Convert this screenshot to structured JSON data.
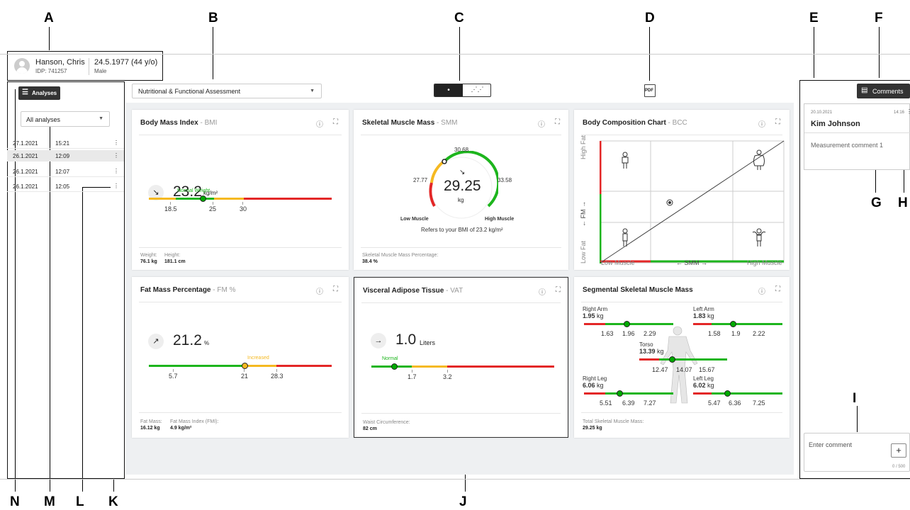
{
  "callouts": {
    "a": "A",
    "b": "B",
    "c": "C",
    "d": "D",
    "e": "E",
    "f": "F",
    "g": "G",
    "h": "H",
    "i": "I",
    "j": "J",
    "k": "K",
    "l": "L",
    "m": "M",
    "n": "N"
  },
  "patient": {
    "name": "Hanson, Chris",
    "idp": "IDP: 741257",
    "dob": "24.5.1977 (44 y/o)",
    "sex": "Male"
  },
  "sidebar": {
    "analyses_label": "Analyses",
    "filter": "All analyses",
    "rows": [
      {
        "date": "27.1.2021",
        "time": "15:21"
      },
      {
        "date": "26.1.2021",
        "time": "12:09"
      },
      {
        "date": "26.1.2021",
        "time": "12:07"
      },
      {
        "date": "26.1.2021",
        "time": "12:05"
      }
    ]
  },
  "assessment": "Nutritional & Functional Assessment",
  "pdf_label": "PDF",
  "bmi": {
    "title": "Body Mass Index",
    "abbr": " - BMI",
    "value": "23.2",
    "unit": "kg/m²",
    "category": "Normal Weight",
    "ticks": [
      "18.5",
      "25",
      "30"
    ],
    "weight_label": "Weight:",
    "weight": "76.1 kg",
    "height_label": "Height:",
    "height": "181.1 cm"
  },
  "smm": {
    "title": "Skeletal Muscle Mass",
    "abbr": " - SMM",
    "value": "29.25",
    "unit": "kg",
    "top": "30.68",
    "left": "27.77",
    "right": "33.58",
    "low": "Low Muscle",
    "high": "High Muscle",
    "note": "Refers to your BMI of 23.2 kg/m²",
    "pct_label": "Skeletal Muscle Mass Percentage:",
    "pct": "38.4 %"
  },
  "bcc": {
    "title": "Body Composition Chart",
    "abbr": " - BCC",
    "y_high": "High Fat",
    "y_mid": "← FM →",
    "y_low": "Low Fat",
    "x_low": "Low Muscle",
    "x_mid": "← SMM →",
    "x_high": "High Muscle"
  },
  "fm": {
    "title": "Fat Mass Percentage",
    "abbr": " - FM %",
    "value": "21.2",
    "unit": "%",
    "category": "Increased",
    "ticks": [
      "5.7",
      "21",
      "28.3"
    ],
    "mass_label": "Fat Mass:",
    "mass": "16.12 kg",
    "fmi_label": "Fat Mass Index (FMI):",
    "fmi": "4.9 kg/m²"
  },
  "vat": {
    "title": "Visceral Adipose Tissue",
    "abbr": " - VAT",
    "value": "1.0",
    "unit": "Liters",
    "category": "Normal",
    "ticks": [
      "1.7",
      "3.2"
    ],
    "waist_label": "Waist Circumference:",
    "waist": "82 cm"
  },
  "seg": {
    "title": "Segmental Skeletal Muscle Mass",
    "ra": {
      "label": "Right Arm",
      "value": "1.95",
      "ticks": [
        "1.63",
        "1.96",
        "2.29"
      ]
    },
    "la": {
      "label": "Left Arm",
      "value": "1.83",
      "ticks": [
        "1.58",
        "1.9",
        "2.22"
      ]
    },
    "to": {
      "label": "Torso",
      "value": "13.39",
      "ticks": [
        "12.47",
        "14.07",
        "15.67"
      ]
    },
    "rl": {
      "label": "Right Leg",
      "value": "6.06",
      "ticks": [
        "5.51",
        "6.39",
        "7.27"
      ]
    },
    "ll": {
      "label": "Left Leg",
      "value": "6.02",
      "ticks": [
        "5.47",
        "6.36",
        "7.25"
      ]
    },
    "unit": "kg",
    "total_label": "Total Skeletal Muscle Mass:",
    "total": "29.25 kg"
  },
  "comments": {
    "button": "Comments",
    "date": "20.10.2021",
    "time": "14:16",
    "author": "Kim Johnson",
    "text": "Measurement comment 1",
    "placeholder": "Enter comment",
    "counter": "0 / 500"
  },
  "colors": {
    "green": "#1db51d",
    "yellow": "#f5b921",
    "red": "#e32727"
  }
}
